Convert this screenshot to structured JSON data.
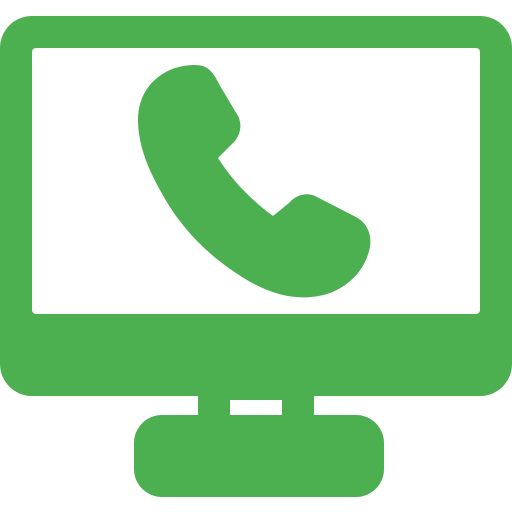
{
  "icon": {
    "name": "computer-phone-call-icon",
    "parts": [
      "monitor-icon",
      "phone-handset-icon",
      "monitor-stand-icon"
    ],
    "colors": {
      "primary": "#4caf50",
      "screen": "#ffffff",
      "background": "#ffffff"
    }
  }
}
